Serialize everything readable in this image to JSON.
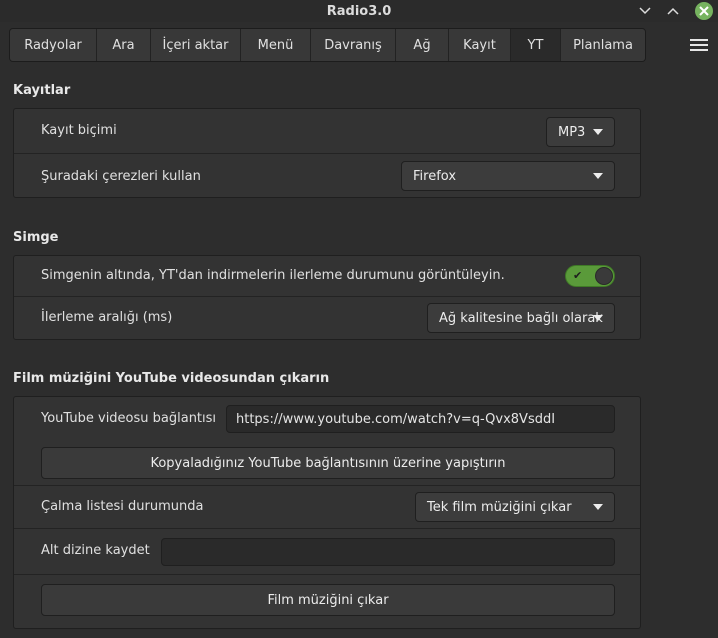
{
  "window": {
    "title": "Radio3.0"
  },
  "tabs": [
    {
      "label": "Radyolar"
    },
    {
      "label": "Ara"
    },
    {
      "label": "İçeri aktar"
    },
    {
      "label": "Menü"
    },
    {
      "label": "Davranış"
    },
    {
      "label": "Ağ"
    },
    {
      "label": "Kayıt"
    },
    {
      "label": "YT",
      "active": true
    },
    {
      "label": "Planlama"
    }
  ],
  "recordings": {
    "title": "Kayıtlar",
    "format_label": "Kayıt biçimi",
    "format_value": "MP3",
    "cookies_label": "Şuradaki çerezleri kullan",
    "cookies_value": "Firefox"
  },
  "icon": {
    "title": "Simge",
    "progress_label": "Simgenin altında, YT'dan indirmelerin ilerleme durumunu görüntüleyin.",
    "progress_enabled": true,
    "interval_label": "İlerleme aralığı (ms)",
    "interval_value": "Ağ kalitesine bağlı olarak"
  },
  "extract": {
    "title": "Film müziğini YouTube videosundan çıkarın",
    "link_label": "YouTube videosu bağlantısı",
    "link_value": "https://www.youtube.com/watch?v=q-Qvx8VsddI",
    "paste_button": "Kopyaladığınız YouTube bağlantısının üzerine yapıştırın",
    "playlist_label": "Çalma listesi durumunda",
    "playlist_value": "Tek film müziğini çıkar",
    "subdir_label": "Alt dizine kaydet",
    "subdir_value": "",
    "extract_button": "Film müziğini çıkar"
  },
  "colors": {
    "accent": "#5a9a3a",
    "close": "#76b35f",
    "background": "#2d2d2d"
  }
}
